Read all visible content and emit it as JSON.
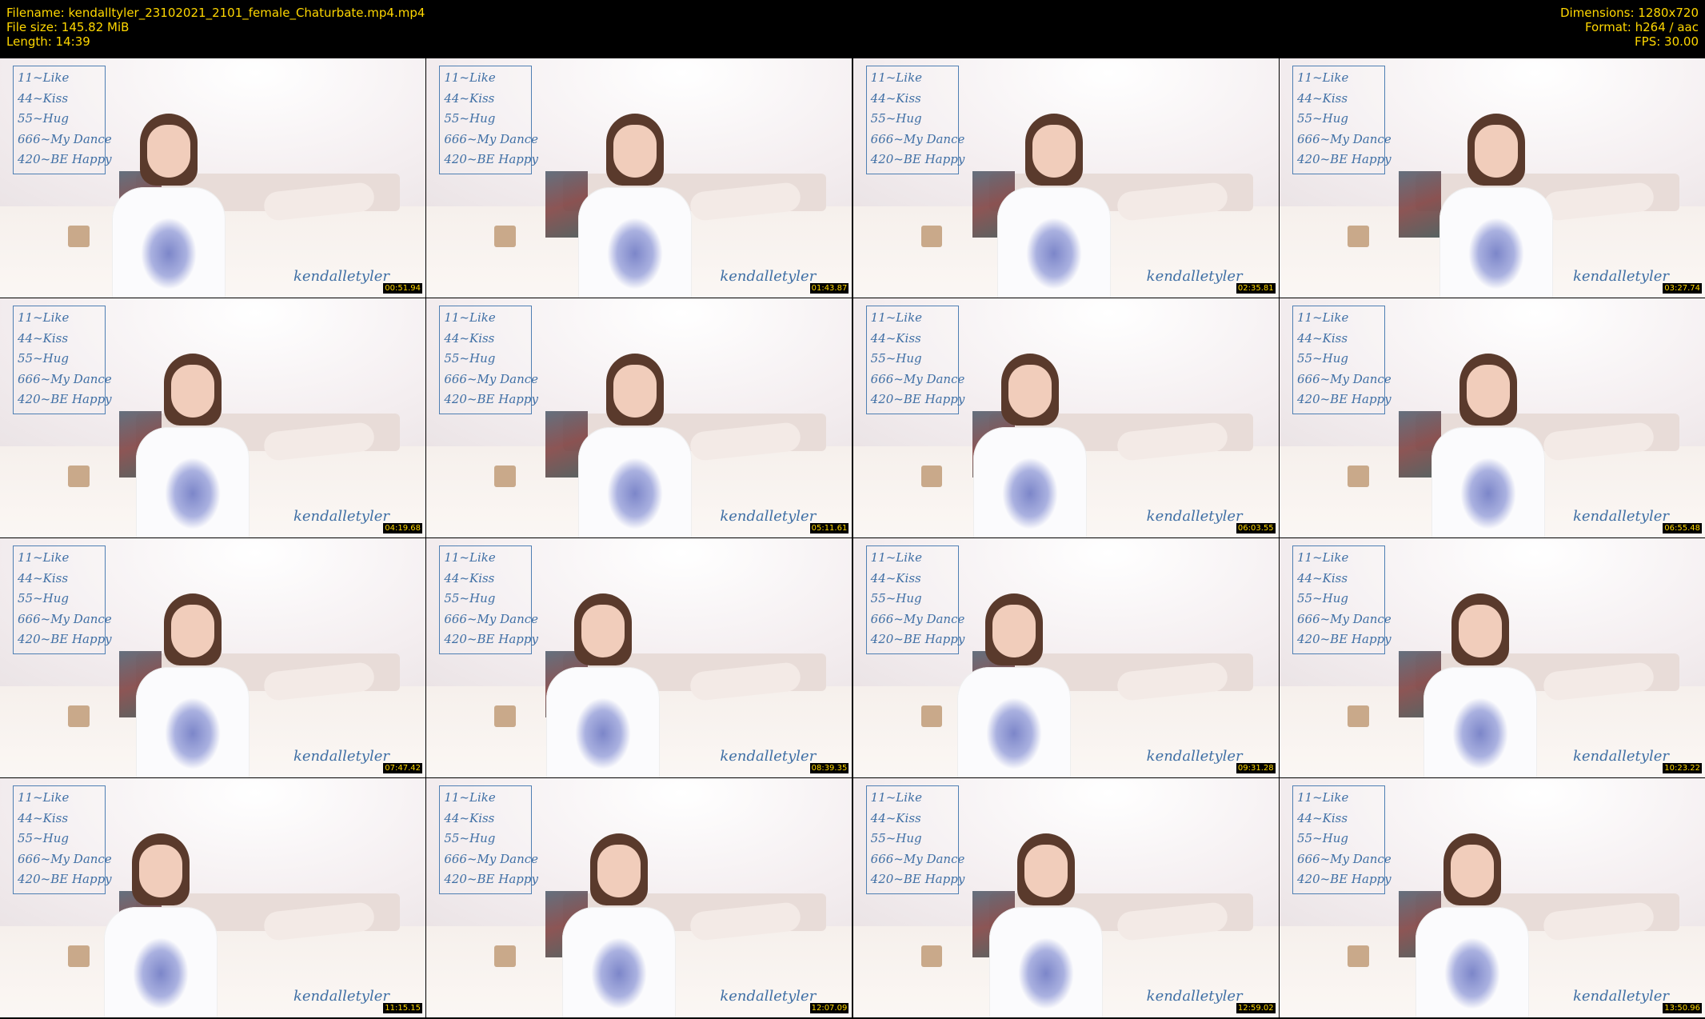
{
  "header": {
    "filename": "Filename: kendalltyler_23102021_2101_female_Chaturbate.mp4.mp4",
    "filesize": "File size: 145.82 MiB",
    "length": "Length: 14:39",
    "dimensions": "Dimensions: 1280x720",
    "format": "Format: h264 / aac",
    "fps": "FPS: 30.00"
  },
  "overlay": {
    "menu_items": [
      "11~Like",
      "44~Kiss",
      "55~Hug",
      "666~My Dance",
      "420~BE Happy"
    ],
    "watermark": "kendalletyler"
  },
  "thumbnails": [
    {
      "timestamp": "00:51.94"
    },
    {
      "timestamp": "01:43.87"
    },
    {
      "timestamp": "02:35.81"
    },
    {
      "timestamp": "03:27.74"
    },
    {
      "timestamp": "04:19.68"
    },
    {
      "timestamp": "05:11.61"
    },
    {
      "timestamp": "06:03.55"
    },
    {
      "timestamp": "06:55.48"
    },
    {
      "timestamp": "07:47.42"
    },
    {
      "timestamp": "08:39.35"
    },
    {
      "timestamp": "09:31.28"
    },
    {
      "timestamp": "10:23.22"
    },
    {
      "timestamp": "11:15.15"
    },
    {
      "timestamp": "12:07.09"
    },
    {
      "timestamp": "12:59.02"
    },
    {
      "timestamp": "13:50.96"
    }
  ],
  "colors": {
    "header_text": "#ffd700",
    "background": "#000000",
    "overlay_blue": "#3f6fa5"
  }
}
